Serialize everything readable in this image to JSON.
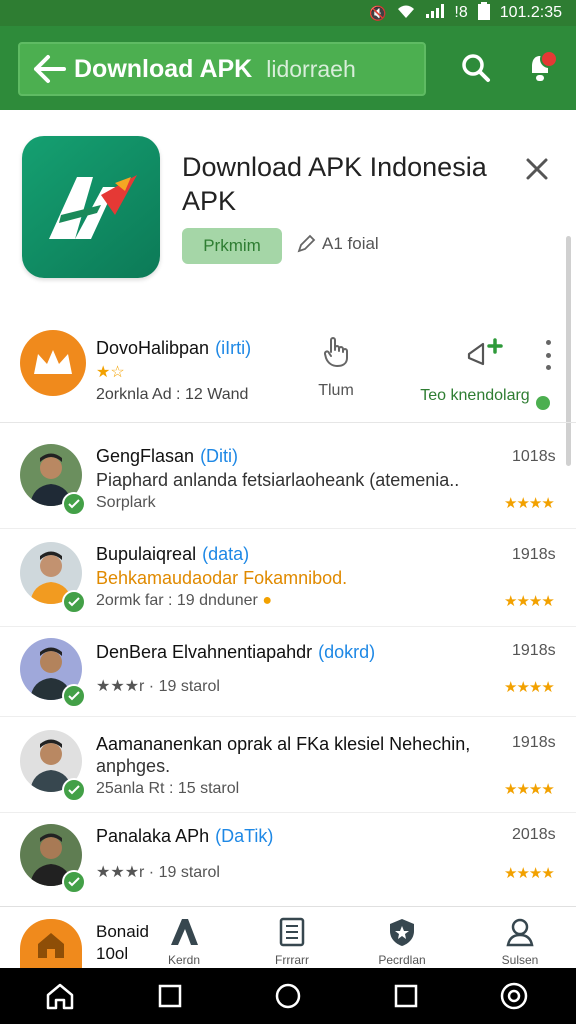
{
  "status_bar": {
    "signal_label": "!8",
    "time": "101.2:35"
  },
  "app_bar": {
    "title": "Download APK",
    "subtitle": "lidorraeh"
  },
  "app": {
    "name": "Download APK Indonesia APK",
    "badge": "Prkmim",
    "secondary": "A1 foial"
  },
  "developer": {
    "name": "DovoHalibpan",
    "tag": "(iIrti)",
    "stars": "★☆",
    "meta": "2orknla Ad : 12 Wand",
    "action_hand": "Tlum",
    "action_recommend": "Teo knendolarg"
  },
  "reviews": [
    {
      "name": "GengFlasan",
      "tag": "(Diti)",
      "text": "Piaphard anlanda fetsiarlaoheank (atemenia..",
      "sub": "Sorplark",
      "time": "1018s",
      "rating": "★★★★"
    },
    {
      "name": "Bupulaiqreal",
      "tag": "(data)",
      "text": "Behkamaudaodar Fokamnibod.",
      "sub": "2ormk far : 19 dnduner",
      "time": "1918s",
      "rating": "★★★★"
    },
    {
      "name": "DenBera Elvahnentiapahdr",
      "tag": "(dokrd)",
      "text": "",
      "sub": "★★★r · 19 starol",
      "time": "1918s",
      "rating": "★★★★"
    },
    {
      "name": "Aamananenkan oprak al FKa klesiel Nehechin,",
      "tag": "",
      "text": "anphges.",
      "sub": "25anla Rt : 15 starol",
      "time": "1918s",
      "rating": "★★★★"
    },
    {
      "name": "Panalaka APh",
      "tag": "(DaTik)",
      "text": "",
      "sub": "★★★r · 19 starol",
      "time": "2018s",
      "rating": "★★★★"
    }
  ],
  "bottom_nav": {
    "home_label_line1": "Bonaid",
    "home_label_line2": "10ol",
    "items": [
      {
        "label": "Kerdn"
      },
      {
        "label": "Frrrarr"
      },
      {
        "label": "Pecrdlan"
      },
      {
        "label": "Sulsen"
      }
    ]
  }
}
